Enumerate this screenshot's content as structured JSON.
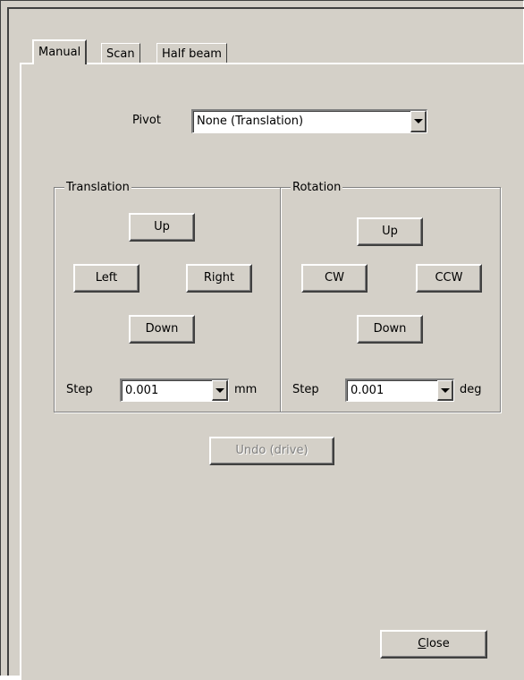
{
  "tabs": [
    "Manual",
    "Scan",
    "Half beam"
  ],
  "pivot": {
    "label": "Pivot",
    "value": "None (Translation)"
  },
  "translation": {
    "title": "Translation",
    "up": "Up",
    "left": "Left",
    "right": "Right",
    "down": "Down",
    "step_label": "Step",
    "step_value": "0.001",
    "unit": "mm"
  },
  "rotation": {
    "title": "Rotation",
    "up": "Up",
    "cw": "CW",
    "ccw": "CCW",
    "down": "Down",
    "step_label": "Step",
    "step_value": "0.001",
    "unit": "deg"
  },
  "undo_label": "Undo (drive)",
  "close_label": "Close",
  "icons": {
    "combo_arrow": "chevron-down-icon"
  },
  "colors": {
    "face": "#d4d0c8",
    "disabled_text": "#808080"
  }
}
